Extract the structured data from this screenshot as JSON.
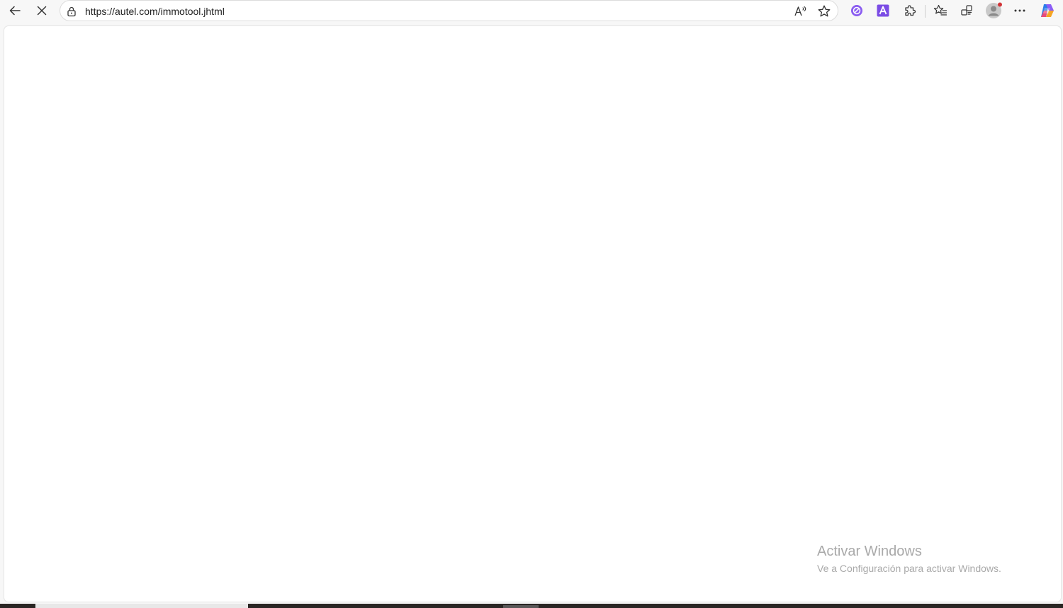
{
  "browser": {
    "url": "https://autel.com/immotool.jhtml",
    "buttons": {
      "back": "arrow-left-icon",
      "stop": "close-icon",
      "read_aloud": "read-aloud-icon",
      "favorite": "star-icon",
      "copilot_ext": "circle-extension-icon",
      "font_ext": "letter-a-extension-icon",
      "extensions": "puzzle-icon",
      "favorites": "favorites-list-icon",
      "collections": "collections-icon",
      "profile": "avatar",
      "more": "ellipsis-icon",
      "copilot": "copilot-icon"
    },
    "colors": {
      "accent_purple": "#7b4ce5",
      "notification_dot": "#d13438"
    }
  },
  "watermark": {
    "title": "Activar Windows",
    "subtitle": "Ve a Configuración para activar Windows."
  }
}
